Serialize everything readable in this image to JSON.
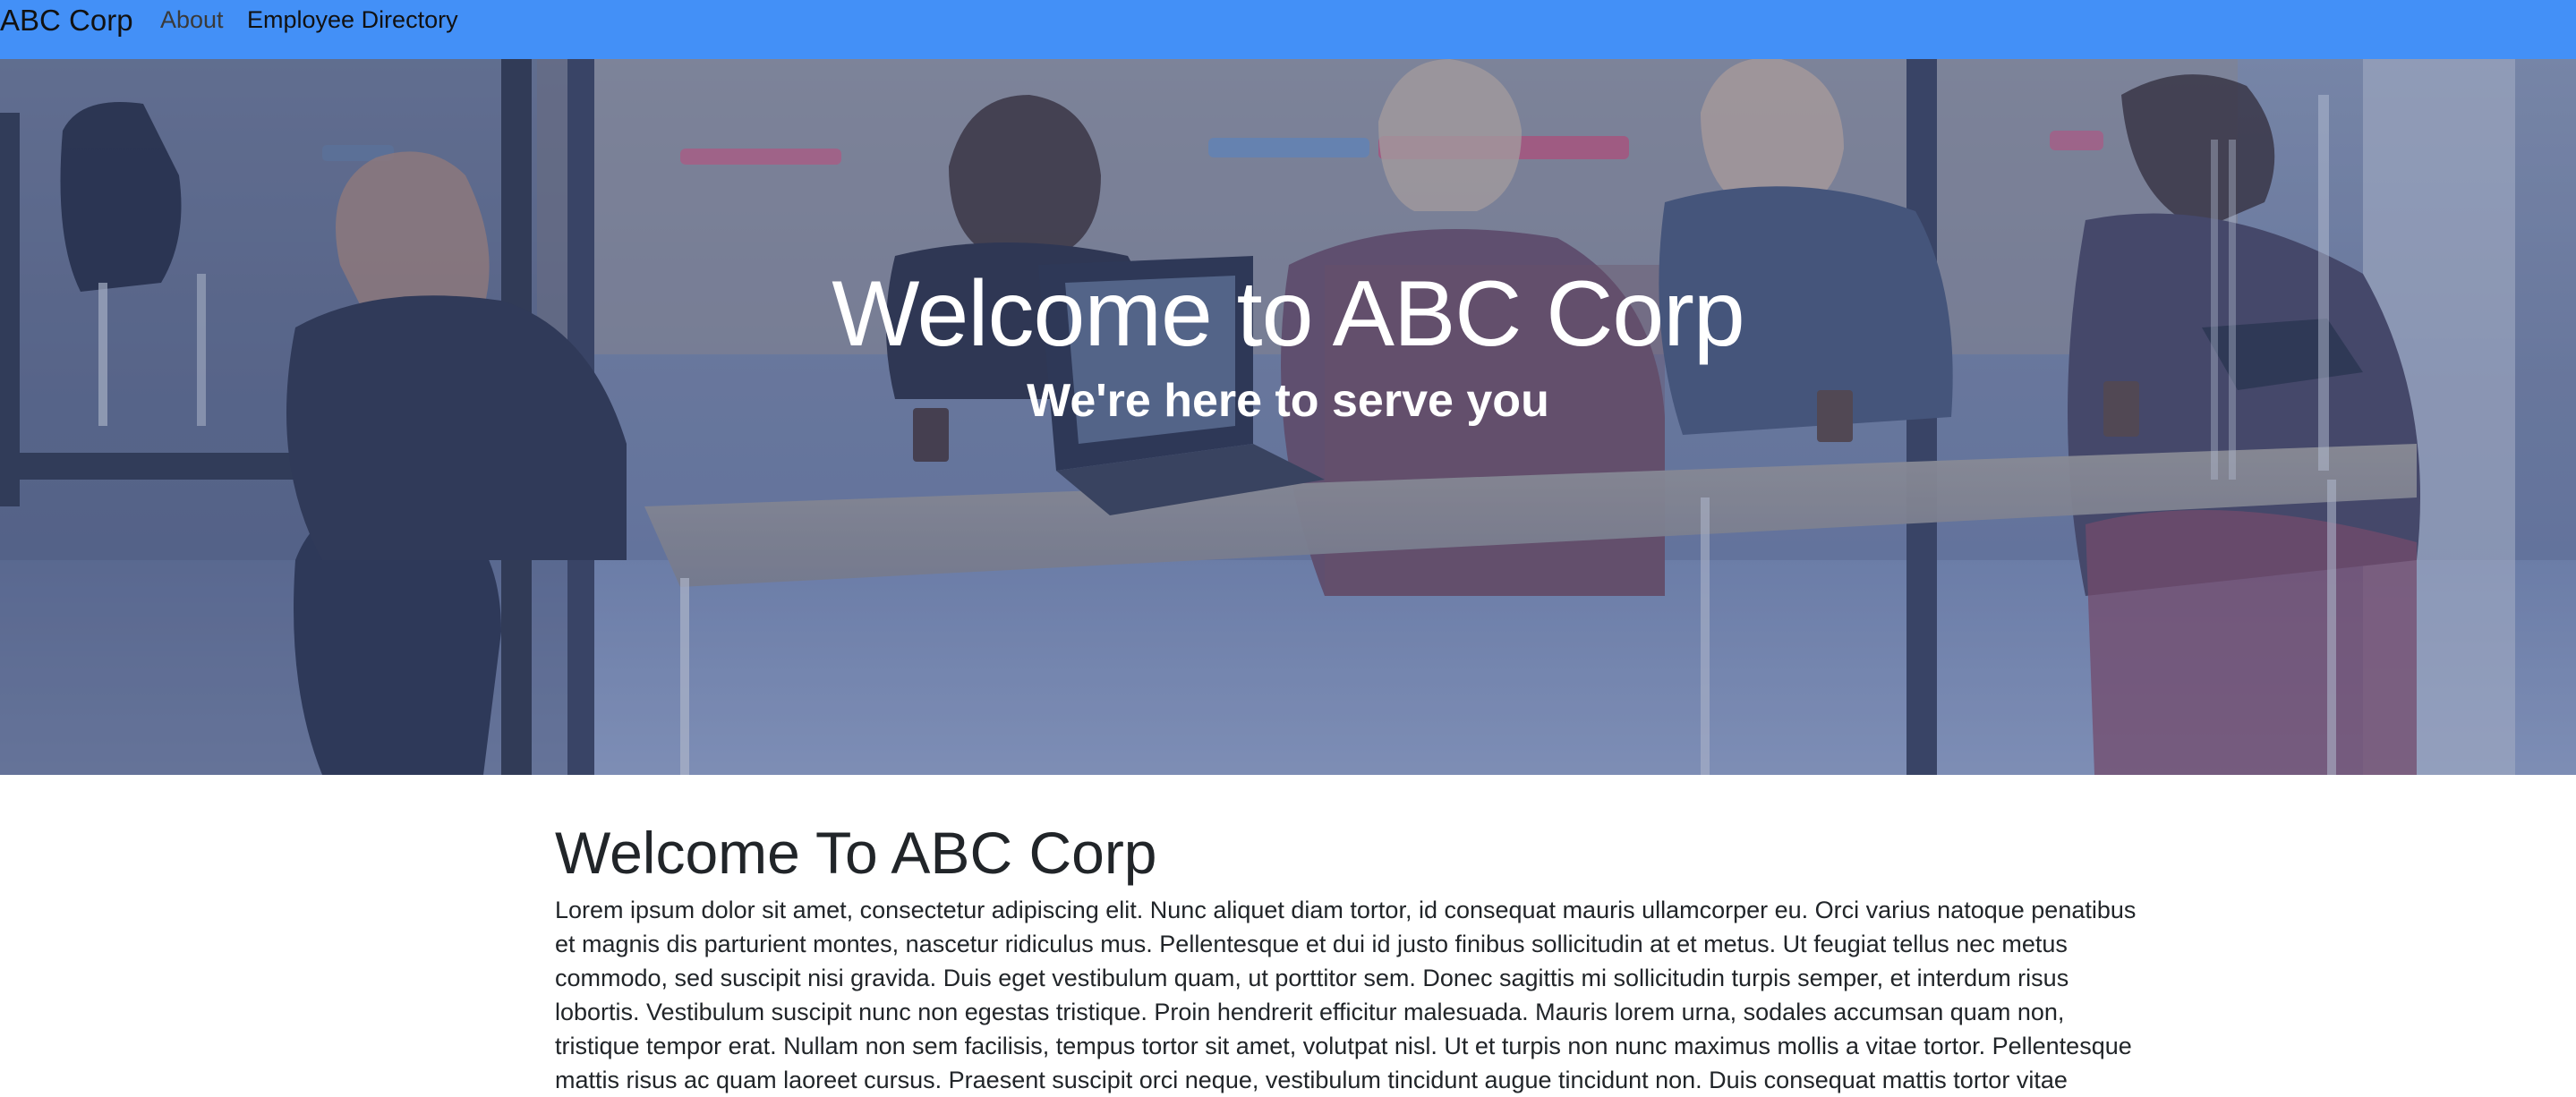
{
  "navbar": {
    "brand": "ABC Corp",
    "links": [
      {
        "label": "About"
      },
      {
        "label": "Employee Directory"
      }
    ],
    "background_color": "#4390f7"
  },
  "hero": {
    "title": "Welcome to ABC Corp",
    "subtitle": "We're here to serve you",
    "background_description_icon": "office-meeting-photo"
  },
  "main": {
    "heading": "Welcome To ABC Corp",
    "body": "Lorem ipsum dolor sit amet, consectetur adipiscing elit. Nunc aliquet diam tortor, id consequat mauris ullamcorper eu. Orci varius natoque penatibus et magnis dis parturient montes, nascetur ridiculus mus. Pellentesque et dui id justo finibus sollicitudin at et metus. Ut feugiat tellus nec metus commodo, sed suscipit nisi gravida. Duis eget vestibulum quam, ut porttitor sem. Donec sagittis mi sollicitudin turpis semper, et interdum risus lobortis. Vestibulum suscipit nunc non egestas tristique. Proin hendrerit efficitur malesuada. Mauris lorem urna, sodales accumsan quam non, tristique tempor erat. Nullam non sem facilisis, tempus tortor sit amet, volutpat nisl. Ut et turpis non nunc maximus mollis a vitae tortor. Pellentesque mattis risus ac quam laoreet cursus. Praesent suscipit orci neque, vestibulum tincidunt augue tincidunt non. Duis consequat mattis tortor vitae"
  }
}
